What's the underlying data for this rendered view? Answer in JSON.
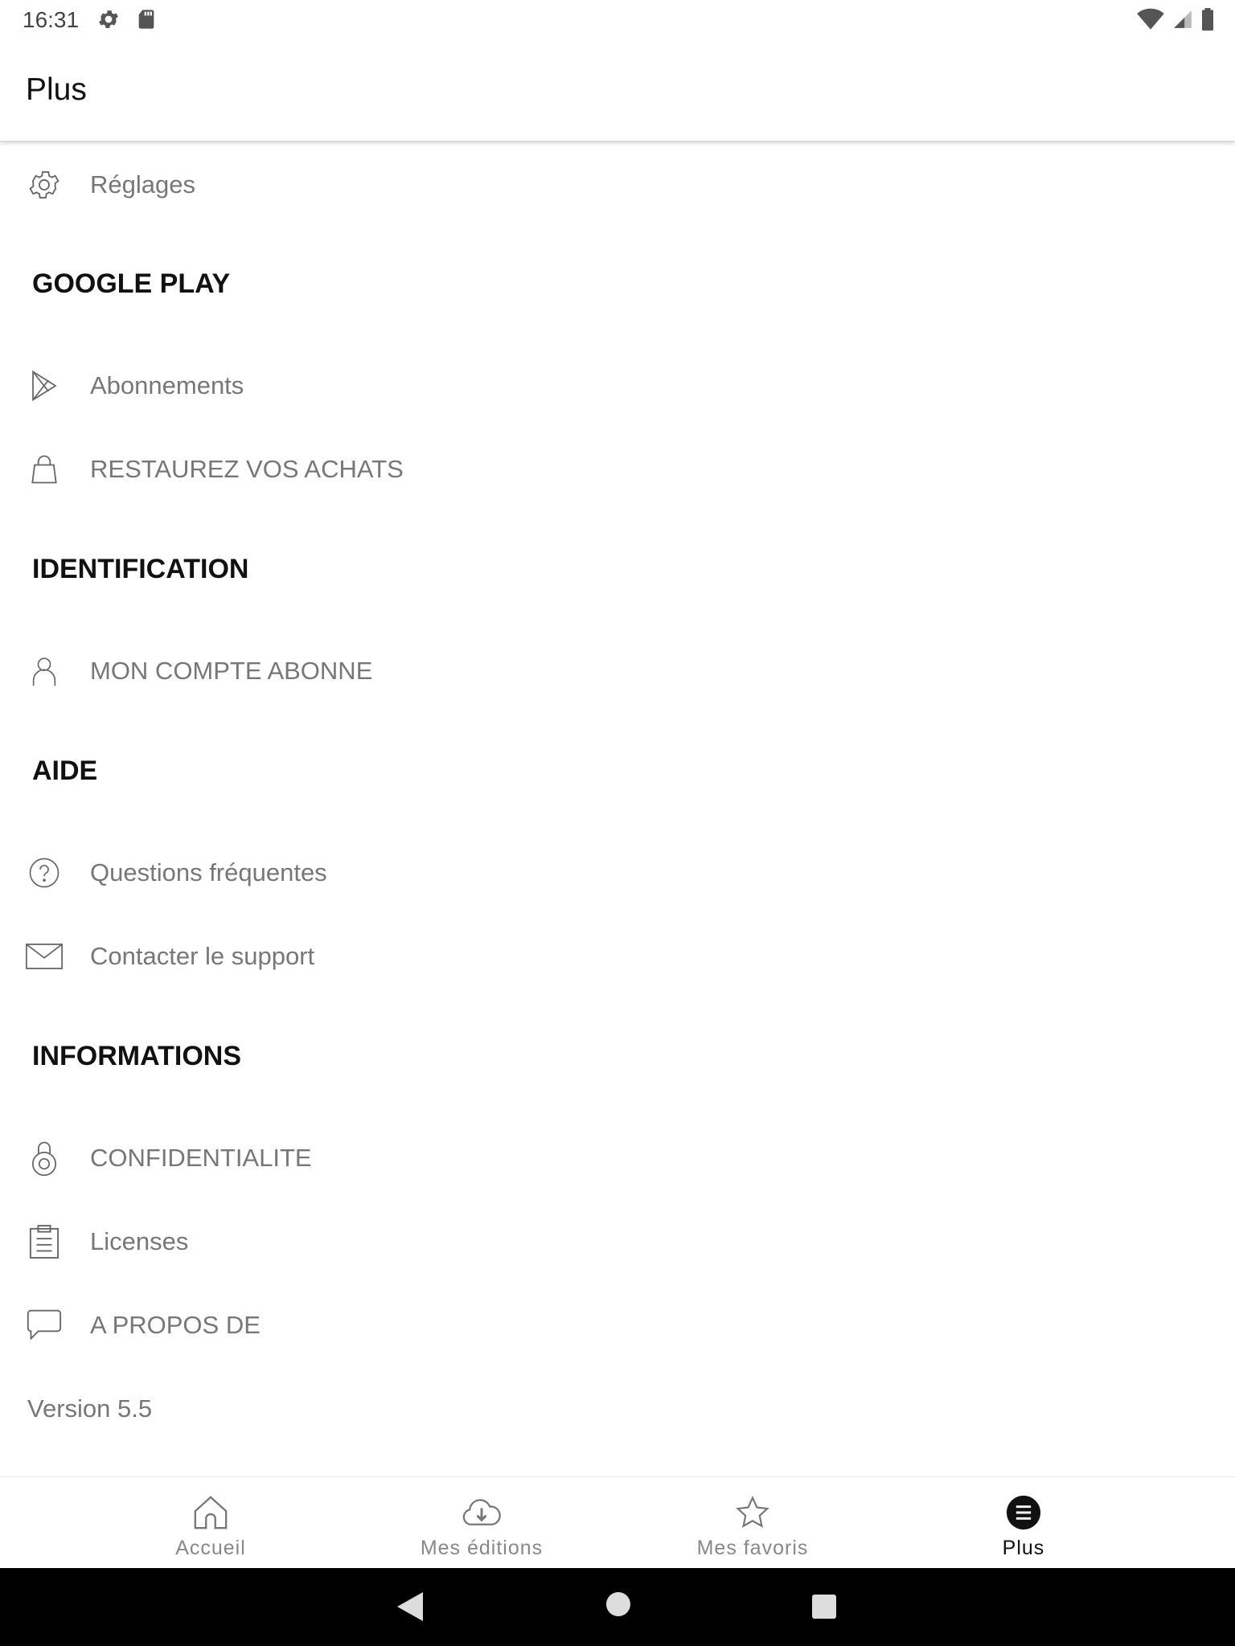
{
  "status_bar": {
    "time": "16:31",
    "left_icons": [
      "gear-icon",
      "sd-card-icon"
    ],
    "right_icons": [
      "wifi-icon",
      "signal-icon",
      "battery-icon"
    ]
  },
  "app_bar": {
    "title": "Plus"
  },
  "menu": {
    "settings": {
      "label": "Réglages",
      "icon": "gear-icon"
    },
    "sections": [
      {
        "header": "GOOGLE PLAY",
        "items": [
          {
            "label": "Abonnements",
            "icon": "play-store-icon"
          },
          {
            "label": "RESTAUREZ VOS ACHATS",
            "icon": "shopping-bag-icon"
          }
        ]
      },
      {
        "header": "IDENTIFICATION",
        "items": [
          {
            "label": "MON COMPTE ABONNE",
            "icon": "user-icon"
          }
        ]
      },
      {
        "header": "AIDE",
        "items": [
          {
            "label": "Questions fréquentes",
            "icon": "help-circle-icon"
          },
          {
            "label": "Contacter le support",
            "icon": "mail-icon"
          }
        ]
      },
      {
        "header": "INFORMATIONS",
        "items": [
          {
            "label": "CONFIDENTIALITE",
            "icon": "padlock-icon"
          },
          {
            "label": "Licenses",
            "icon": "clipboard-icon"
          },
          {
            "label": "A PROPOS DE",
            "icon": "speech-bubble-icon"
          }
        ]
      }
    ],
    "version": "Version 5.5"
  },
  "bottom_nav": {
    "items": [
      {
        "label": "Accueil",
        "icon": "home-icon",
        "active": false
      },
      {
        "label": "Mes éditions",
        "icon": "cloud-download-icon",
        "active": false
      },
      {
        "label": "Mes favoris",
        "icon": "star-icon",
        "active": false
      },
      {
        "label": "Plus",
        "icon": "menu-circle-icon",
        "active": true
      }
    ]
  },
  "system_nav": [
    "back-icon",
    "home-circle-icon",
    "recents-icon"
  ],
  "colors": {
    "text_primary": "#111111",
    "text_secondary": "#777777",
    "nav_inactive": "#888888",
    "background": "#ffffff",
    "system_nav_bg": "#000000"
  }
}
